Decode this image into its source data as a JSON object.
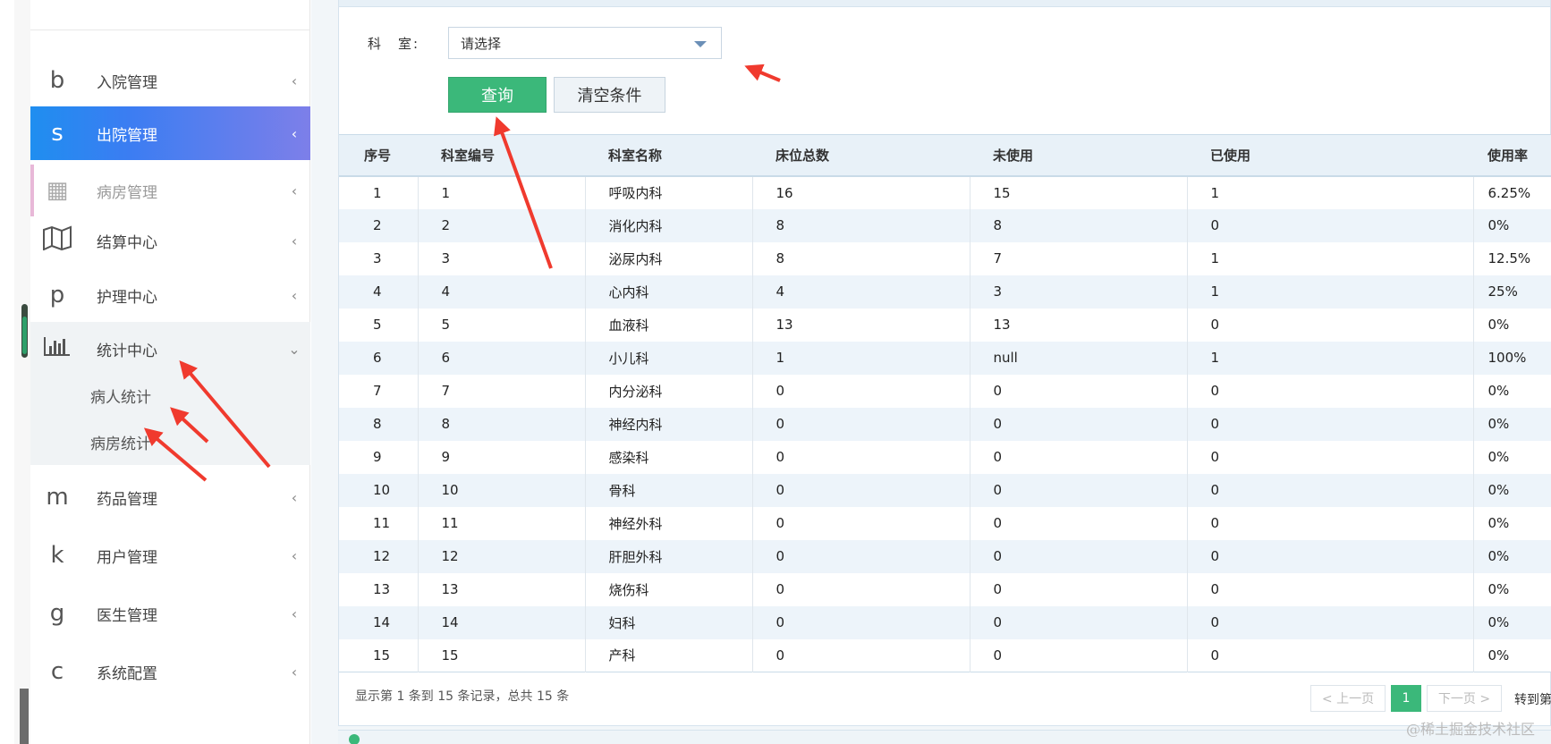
{
  "sidebar": {
    "items": [
      {
        "icon": "b",
        "label": "入院管理",
        "arrow": "‹"
      },
      {
        "icon": "s",
        "label": "出院管理",
        "arrow": "‹"
      },
      {
        "icon": "▦",
        "label": "病房管理",
        "arrow": "‹"
      },
      {
        "icon": "▥",
        "label": "结算中心",
        "arrow": "‹"
      },
      {
        "icon": "p",
        "label": "护理中心",
        "arrow": "‹"
      },
      {
        "icon": "▟",
        "label": "统计中心",
        "arrow": "⌄"
      },
      {
        "icon": "m",
        "label": "药品管理",
        "arrow": "‹"
      },
      {
        "icon": "k",
        "label": "用户管理",
        "arrow": "‹"
      },
      {
        "icon": "g",
        "label": "医生管理",
        "arrow": "‹"
      },
      {
        "icon": "c",
        "label": "系统配置",
        "arrow": "‹"
      }
    ],
    "stats_sub": [
      "病人统计",
      "病房统计"
    ]
  },
  "filter": {
    "label": "科　室:",
    "select_value": "请选择",
    "query_label": "查询",
    "clear_label": "清空条件"
  },
  "table": {
    "headers": [
      "序号",
      "科室编号",
      "科室名称",
      "床位总数",
      "未使用",
      "已使用",
      "使用率"
    ],
    "rows": [
      [
        "1",
        "1",
        "呼吸内科",
        "16",
        "15",
        "1",
        "6.25%"
      ],
      [
        "2",
        "2",
        "消化内科",
        "8",
        "8",
        "0",
        "0%"
      ],
      [
        "3",
        "3",
        "泌尿内科",
        "8",
        "7",
        "1",
        "12.5%"
      ],
      [
        "4",
        "4",
        "心内科",
        "4",
        "3",
        "1",
        "25%"
      ],
      [
        "5",
        "5",
        "血液科",
        "13",
        "13",
        "0",
        "0%"
      ],
      [
        "6",
        "6",
        "小儿科",
        "1",
        "null",
        "1",
        "100%"
      ],
      [
        "7",
        "7",
        "内分泌科",
        "0",
        "0",
        "0",
        "0%"
      ],
      [
        "8",
        "8",
        "神经内科",
        "0",
        "0",
        "0",
        "0%"
      ],
      [
        "9",
        "9",
        "感染科",
        "0",
        "0",
        "0",
        "0%"
      ],
      [
        "10",
        "10",
        "骨科",
        "0",
        "0",
        "0",
        "0%"
      ],
      [
        "11",
        "11",
        "神经外科",
        "0",
        "0",
        "0",
        "0%"
      ],
      [
        "12",
        "12",
        "肝胆外科",
        "0",
        "0",
        "0",
        "0%"
      ],
      [
        "13",
        "13",
        "烧伤科",
        "0",
        "0",
        "0",
        "0%"
      ],
      [
        "14",
        "14",
        "妇科",
        "0",
        "0",
        "0",
        "0%"
      ],
      [
        "15",
        "15",
        "产科",
        "0",
        "0",
        "0",
        "0%"
      ]
    ]
  },
  "pagination": {
    "info": "显示第 1 条到 15 条记录，总共 15 条",
    "prev": "< 上一页",
    "current": "1",
    "next": "下一页 >",
    "goto": "转到第"
  },
  "watermark": "@稀土掘金技术社区",
  "colors": {
    "accent_green": "#3bb87a",
    "active_gradient_start": "#1f8ef0",
    "active_gradient_end": "#7d7fe9",
    "arrow_red": "#f03a2e"
  }
}
